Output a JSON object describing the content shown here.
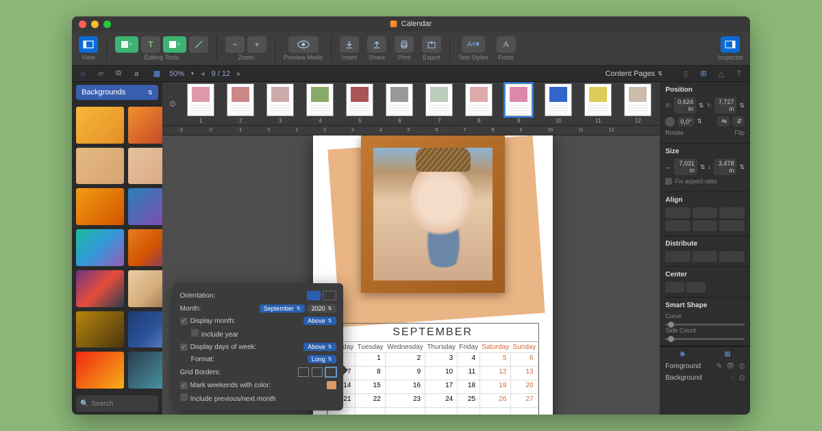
{
  "window": {
    "title": "Calendar"
  },
  "toolbar": {
    "view": "View",
    "editing": "Editing Tools",
    "zoom": "Zoom",
    "preview": "Preview Mode",
    "insert": "Insert",
    "share": "Share",
    "print": "Print",
    "export": "Export",
    "text_styles": "Text Styles",
    "fonts": "Fonts",
    "inspector": "Inspector"
  },
  "subbar": {
    "zoom": "50%",
    "page_of": "9 / 12",
    "content_pages": "Content Pages"
  },
  "sidebar": {
    "title": "Backgrounds",
    "search": "Search",
    "swatches": [
      "linear-gradient(135deg,#f6b93b,#e58e26)",
      "linear-gradient(135deg,#f0932b,#c0392b)",
      "linear-gradient(135deg,#e6b980,#d4a373)",
      "linear-gradient(135deg,#e5c29f,#d8a47f)",
      "linear-gradient(135deg,#f39c12,#d35400)",
      "linear-gradient(135deg,#2980b9,#8e44ad)",
      "linear-gradient(135deg,#1abc9c,#3498db,#9b59b6)",
      "linear-gradient(135deg,#e67e22,#d35400,#6c3483)",
      "linear-gradient(135deg,#6c3483,#e74c3c,#2c3e50)",
      "linear-gradient(135deg,#eacda3,#d6ae7b,#8e6b4e)",
      "linear-gradient(135deg,#b8860b,#4a3510)",
      "linear-gradient(135deg,#1e3c72,#2a5298,#6a89cc)",
      "linear-gradient(135deg,#f12711,#f5af19)",
      "linear-gradient(135deg,#2c3e50,#4ca1af)"
    ]
  },
  "pagestrip": {
    "colors": [
      "#d9a",
      "#c88",
      "#caa",
      "#8a6",
      "#a55",
      "#999",
      "#bcb",
      "#daa",
      "#d8a",
      "#36c",
      "#dc5",
      "#cba"
    ],
    "selected": 9
  },
  "ruler": [
    "-3",
    "-2",
    "-1",
    "0",
    "1",
    "2",
    "3",
    "4",
    "5",
    "6",
    "7",
    "8",
    "9",
    "10",
    "11",
    "12"
  ],
  "calendar": {
    "month_title": "SEPTEMBER",
    "days": [
      "Monday",
      "Tuesday",
      "Wednesday",
      "Thursday",
      "Friday",
      "Saturday",
      "Sunday"
    ],
    "weeks": [
      [
        "",
        "1",
        "2",
        "3",
        "4",
        "5",
        "6"
      ],
      [
        "7",
        "8",
        "9",
        "10",
        "11",
        "12",
        "13"
      ],
      [
        "14",
        "15",
        "16",
        "17",
        "18",
        "19",
        "20"
      ],
      [
        "21",
        "22",
        "23",
        "24",
        "25",
        "26",
        "27"
      ],
      [
        "",
        "",
        "",
        "",
        "",
        "",
        ""
      ]
    ]
  },
  "popup": {
    "orientation": "Orientation:",
    "month_label": "Month:",
    "month_value": "September",
    "year_value": "2020",
    "display_month": "Display month:",
    "display_month_pos": "Above",
    "include_year": "Include year",
    "display_dow": "Display days of week:",
    "dow_pos": "Above",
    "format_label": "Format:",
    "format_value": "Long",
    "grid_borders": "Grid Borders:",
    "mark_weekends": "Mark weekends with color:",
    "include_adjacent": "Include previous/next month"
  },
  "inspector": {
    "position": "Position",
    "x": "X:",
    "x_val": "0,624 in",
    "y": "Y:",
    "y_val": "7,727 in",
    "rotate_val": "0,0°",
    "rotate": "Rotate",
    "flip": "Flip",
    "size": "Size",
    "w_val": "7,031 in",
    "h_val": "3,478 in",
    "fix_ratio": "Fix aspect ratio",
    "align": "Align",
    "distribute": "Distribute",
    "center": "Center",
    "smart": "Smart Shape",
    "curve": "Curve",
    "side_count": "Side Count",
    "foreground": "Foreground",
    "background": "Background"
  }
}
